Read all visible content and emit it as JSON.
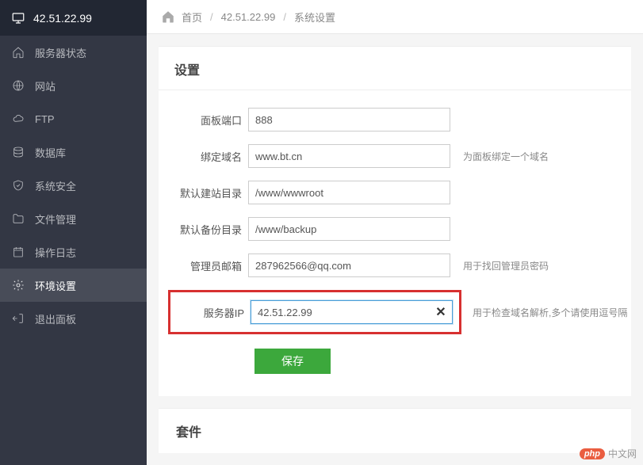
{
  "header": {
    "title": "42.51.22.99"
  },
  "sidebar": {
    "items": [
      {
        "label": "服务器状态",
        "icon": "home-icon"
      },
      {
        "label": "网站",
        "icon": "globe-icon"
      },
      {
        "label": "FTP",
        "icon": "cloud-icon"
      },
      {
        "label": "数据库",
        "icon": "database-icon"
      },
      {
        "label": "系统安全",
        "icon": "shield-icon"
      },
      {
        "label": "文件管理",
        "icon": "folder-icon"
      },
      {
        "label": "操作日志",
        "icon": "calendar-icon"
      },
      {
        "label": "环境设置",
        "icon": "gear-icon",
        "active": true
      },
      {
        "label": "退出面板",
        "icon": "logout-icon"
      }
    ]
  },
  "breadcrumb": {
    "home": "首页",
    "server": "42.51.22.99",
    "page": "系统设置"
  },
  "settings": {
    "title": "设置",
    "panel_port": {
      "label": "面板端口",
      "value": "888"
    },
    "bind_domain": {
      "label": "绑定域名",
      "value": "www.bt.cn",
      "hint": "为面板绑定一个域名"
    },
    "default_site_dir": {
      "label": "默认建站目录",
      "value": "/www/wwwroot"
    },
    "default_backup_dir": {
      "label": "默认备份目录",
      "value": "/www/backup"
    },
    "admin_email": {
      "label": "管理员邮箱",
      "value": "287962566@qq.com",
      "hint": "用于找回管理员密码"
    },
    "server_ip": {
      "label": "服务器IP",
      "value": "42.51.22.99",
      "hint": "用于检查域名解析,多个请使用逗号隔"
    },
    "save_label": "保存"
  },
  "suite": {
    "title": "套件"
  },
  "watermark": {
    "badge": "php",
    "text": "中文网"
  }
}
